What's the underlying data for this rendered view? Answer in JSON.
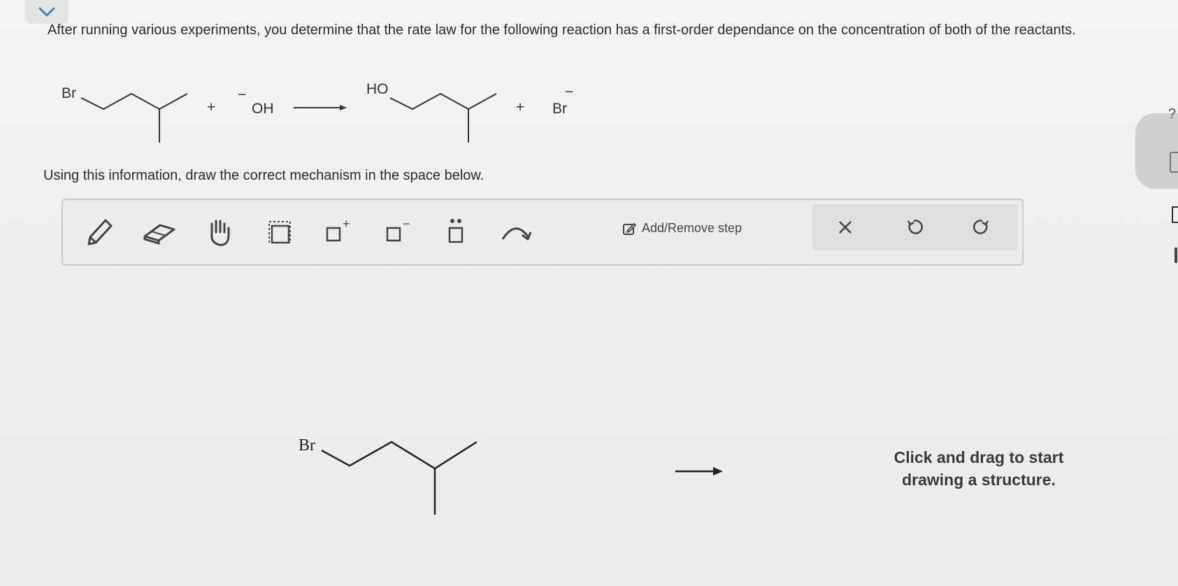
{
  "question": {
    "text": "After running various experiments, you determine that the rate law for the following reaction has a first-order dependance on the concentration of both of the reactants."
  },
  "scheme": {
    "reactant1_label": "Br",
    "plus1": "+",
    "reactant2_label": "OH",
    "reactant2_charge": "−",
    "product1_label": "HO",
    "plus2": "+",
    "product2_label": "Br",
    "product2_charge": "−"
  },
  "instruction": "Using this information, draw the correct mechanism in the space below.",
  "toolbar": {
    "tools": [
      {
        "name": "pencil",
        "icon": "pencil-icon"
      },
      {
        "name": "eraser",
        "icon": "eraser-icon"
      },
      {
        "name": "hand",
        "icon": "hand-icon"
      },
      {
        "name": "select",
        "icon": "selection-box-icon"
      },
      {
        "name": "add-positive-charge",
        "icon": "positive-charge-icon",
        "symbol": "+"
      },
      {
        "name": "add-negative-charge",
        "icon": "negative-charge-icon",
        "symbol": "−"
      },
      {
        "name": "add-lone-pair",
        "icon": "lone-pair-icon"
      },
      {
        "name": "curved-arrow",
        "icon": "curved-arrow-icon"
      }
    ],
    "add_remove_step_label": "Add/Remove step",
    "actions": [
      {
        "name": "clear",
        "icon": "close-icon"
      },
      {
        "name": "undo",
        "icon": "undo-icon"
      },
      {
        "name": "redo",
        "icon": "redo-icon"
      }
    ]
  },
  "canvas": {
    "starting_structure_label": "Br",
    "hint_line1": "Click and drag to start",
    "hint_line2": "drawing a structure."
  },
  "side_panel": {
    "help_symbol": "?"
  }
}
